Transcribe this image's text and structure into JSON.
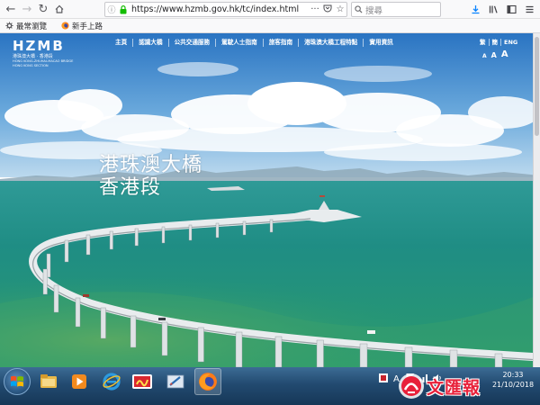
{
  "browser": {
    "url": "https://www.hzmb.gov.hk/tc/index.html",
    "search_placeholder": "搜尋",
    "bookmarks": [
      {
        "label": "最常瀏覽",
        "icon": "gear-icon"
      },
      {
        "label": "新手上路",
        "icon": "firefox-icon"
      }
    ]
  },
  "site": {
    "logo": "HZMB",
    "logo_sub_1": "港珠澳大橋 · 香港段",
    "logo_sub_2": "HONG KONG-ZHUHAI-MACAO BRIDGE",
    "logo_sub_3": "HONG KONG SECTION",
    "nav": [
      "主頁",
      "認識大橋",
      "公共交通服務",
      "駕駛人士指南",
      "旅客指南",
      "港珠澳大橋工程特點",
      "實用資訊"
    ],
    "lang": [
      "繁",
      "簡",
      "ENG"
    ],
    "font_sizes": [
      "A",
      "A",
      "A"
    ],
    "hero_line1": "港珠澳大橋",
    "hero_line2": "香港段"
  },
  "taskbar": {
    "apps": [
      "windows-explorer-icon",
      "media-player-icon",
      "internet-explorer-icon",
      "news-app-icon",
      "paint-icon",
      "firefox-icon"
    ],
    "time": "20:33",
    "date": "21/10/2018"
  },
  "watermark": "文匯報",
  "colors": {
    "sky_top": "#2d7ec8",
    "sea": "#1f8f86",
    "taskbar": "#224a70",
    "watermark": "#e8213a"
  }
}
